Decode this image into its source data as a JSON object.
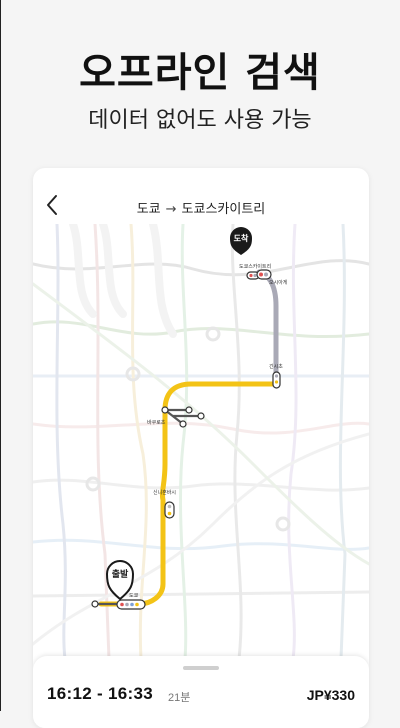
{
  "headline": "오프라인 검색",
  "subline": "데이터 없어도 사용 가능",
  "route": {
    "from": "도쿄",
    "arrow": "→",
    "to": "도쿄스카이트리"
  },
  "map": {
    "arrival_badge": "도착",
    "departure_badge": "출발",
    "station_labels": [
      "도쿄스카이트리",
      "오시아게",
      "긴시초",
      "바쿠로초",
      "신니혼바시",
      "도쿄"
    ]
  },
  "result": {
    "time_range": "16:12 - 16:33",
    "duration": "21분",
    "fare": "JP¥330"
  },
  "colors": {
    "yellow_line": "#f3c316",
    "gray_line": "#a9a9b6",
    "marker": "#1a1a1a"
  },
  "icons": [
    "back-chevron-icon",
    "arrival-pin-icon",
    "departure-pin-icon"
  ]
}
